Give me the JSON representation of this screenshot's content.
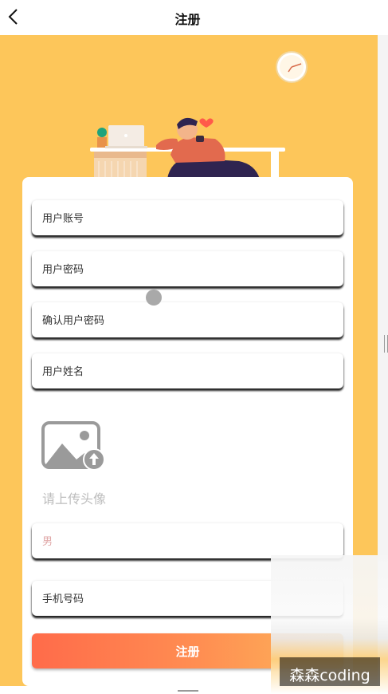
{
  "header": {
    "title": "注册",
    "back_icon": "chevron-left-icon"
  },
  "form": {
    "fields": [
      {
        "label": "用户账号"
      },
      {
        "label": "用户密码"
      },
      {
        "label": "确认用户密码"
      },
      {
        "label": "用户姓名"
      },
      {
        "label": "男"
      },
      {
        "label": "手机号码"
      }
    ],
    "upload": {
      "icon": "image-upload-icon",
      "label": "请上传头像"
    },
    "submit_label": "注册"
  },
  "watermark": {
    "text": "森森coding"
  },
  "colors": {
    "banner": "#FDC65A",
    "button_start": "#FF6B4A",
    "button_end": "#FDB85A"
  }
}
